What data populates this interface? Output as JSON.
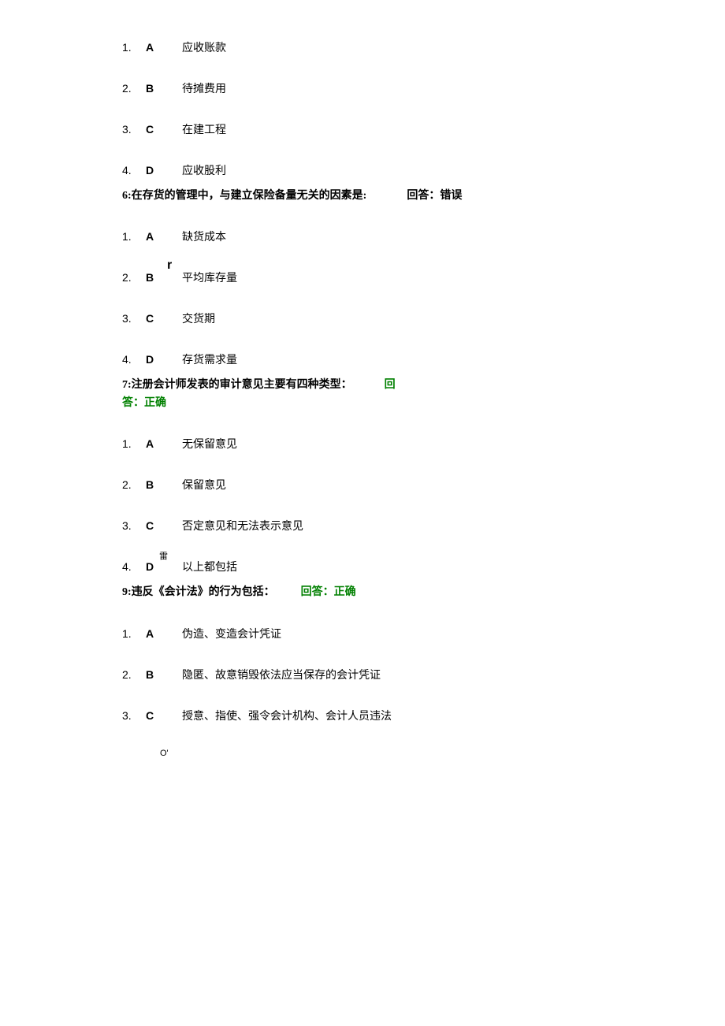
{
  "q5_options": [
    {
      "num": "1.",
      "letter": "A",
      "text": "应收账款"
    },
    {
      "num": "2.",
      "letter": "B",
      "text": "待摊费用"
    },
    {
      "num": "3.",
      "letter": "C",
      "text": "在建工程"
    },
    {
      "num": "4.",
      "letter": "D",
      "text": "应收股利"
    }
  ],
  "q6": {
    "text": "6:在存货的管理中，与建立保险备量无关的因素是:",
    "ans_label": "回答：错误",
    "options": [
      {
        "num": "1.",
        "letter": "A",
        "text": "缺货成本",
        "marker": null
      },
      {
        "num": "2.",
        "letter": "B",
        "text": "平均库存量",
        "marker": "r"
      },
      {
        "num": "3.",
        "letter": "C",
        "text": "交货期",
        "marker": null
      },
      {
        "num": "4.",
        "letter": "D",
        "text": "存货需求量",
        "marker": null
      }
    ]
  },
  "q7": {
    "text": "7:注册会计师发表的审计意见主要有四种类型：",
    "ans_label": "回答：正确",
    "options": [
      {
        "num": "1.",
        "letter": "A",
        "text": "无保留意见",
        "marker": null
      },
      {
        "num": "2.",
        "letter": "B",
        "text": "保留意见",
        "marker": null
      },
      {
        "num": "3.",
        "letter": "C",
        "text": "否定意见和无法表示意见",
        "marker": null
      },
      {
        "num": "4.",
        "letter": "D",
        "text": "以上都包括",
        "marker": "雷"
      }
    ]
  },
  "q9": {
    "text": "9:违反《会计法》的行为包括：",
    "ans_label": "回答：正确",
    "options": [
      {
        "num": "1.",
        "letter": "A",
        "text": "伪造、变造会计凭证"
      },
      {
        "num": "2.",
        "letter": "B",
        "text": "隐匿、故意销毁依法应当保存的会计凭证"
      },
      {
        "num": "3.",
        "letter": "C",
        "text": "授意、指使、强令会计机构、会计人员违法"
      }
    ]
  },
  "end_marker": "O'"
}
